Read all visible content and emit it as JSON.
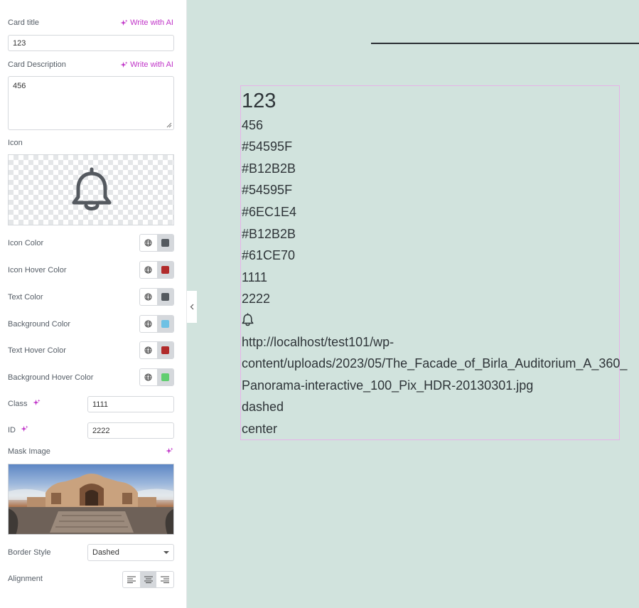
{
  "panel": {
    "card_title_label": "Card title",
    "write_ai": "Write with AI",
    "card_title_value": "123",
    "card_desc_label": "Card Description",
    "card_desc_value": "456",
    "icon_label": "Icon",
    "icon_name": "bell-icon",
    "colors": [
      {
        "label": "Icon Color",
        "value": "#54595F"
      },
      {
        "label": "Icon Hover Color",
        "value": "#B12B2B"
      },
      {
        "label": "Text Color",
        "value": "#54595F"
      },
      {
        "label": "Background Color",
        "value": "#6EC1E4"
      },
      {
        "label": "Text Hover Color",
        "value": "#B12B2B"
      },
      {
        "label": "Background Hover Color",
        "value": "#61CE70"
      }
    ],
    "class_label": "Class",
    "class_value": "1111",
    "id_label": "ID",
    "id_value": "2222",
    "mask_label": "Mask Image",
    "border_label": "Border Style",
    "border_value": "Dashed",
    "alignment_label": "Alignment",
    "alignment_selected": "center"
  },
  "preview": {
    "title": "123",
    "lines": [
      "456",
      "#54595F",
      "#B12B2B",
      "#54595F",
      "#6EC1E4",
      "#B12B2B",
      "#61CE70",
      "1111",
      "2222"
    ],
    "url_lines": [
      "http://localhost/test101/wp-",
      "content/uploads/2023/05/The_Facade_of_Birla_Auditorium_A_360_",
      "Panorama-interactive_100_Pix_HDR-20130301.jpg"
    ],
    "border_text": "dashed",
    "align_text": "center"
  },
  "theme": {
    "accent": "#c034c8",
    "preview_bg": "#d1e3dd",
    "card_border": "#e6b3e8"
  }
}
